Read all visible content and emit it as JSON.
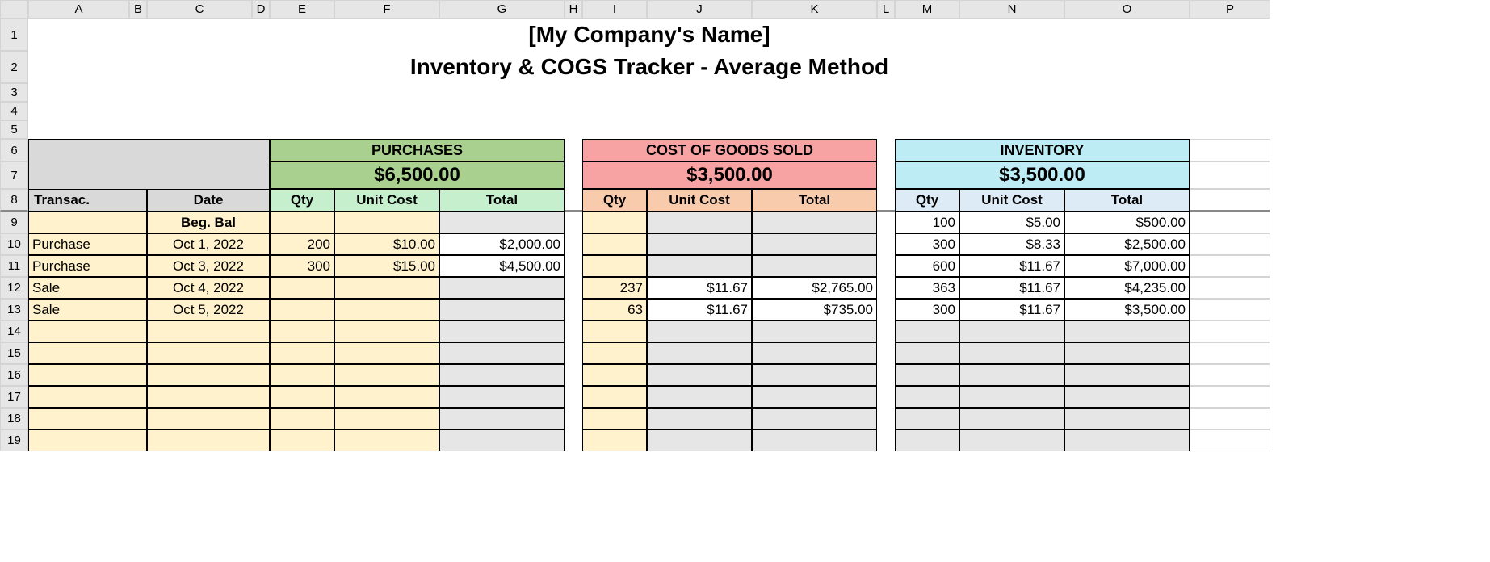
{
  "columns": [
    "",
    "A",
    "B",
    "C",
    "D",
    "E",
    "F",
    "G",
    "H",
    "I",
    "J",
    "K",
    "L",
    "M",
    "N",
    "O",
    "P"
  ],
  "title1": "[My Company's Name]",
  "title2": "Inventory & COGS Tracker - Average Method",
  "sections": {
    "purchases": {
      "label": "PURCHASES",
      "total": "$6,500.00"
    },
    "cogs": {
      "label": "COST OF GOODS SOLD",
      "total": "$3,500.00"
    },
    "inventory": {
      "label": "INVENTORY",
      "total": "$3,500.00"
    }
  },
  "headers": {
    "transac": "Transac.",
    "date": "Date",
    "qty": "Qty",
    "unitcost": "Unit Cost",
    "total": "Total"
  },
  "rows": [
    {
      "transac": "",
      "date": "Beg. Bal",
      "p_qty": "",
      "p_uc": "",
      "p_tot": "",
      "c_qty": "",
      "c_uc": "",
      "c_tot": "",
      "i_qty": "100",
      "i_uc": "$5.00",
      "i_tot": "$500.00"
    },
    {
      "transac": "Purchase",
      "date": "Oct 1, 2022",
      "p_qty": "200",
      "p_uc": "$10.00",
      "p_tot": "$2,000.00",
      "c_qty": "",
      "c_uc": "",
      "c_tot": "",
      "i_qty": "300",
      "i_uc": "$8.33",
      "i_tot": "$2,500.00"
    },
    {
      "transac": "Purchase",
      "date": "Oct 3, 2022",
      "p_qty": "300",
      "p_uc": "$15.00",
      "p_tot": "$4,500.00",
      "c_qty": "",
      "c_uc": "",
      "c_tot": "",
      "i_qty": "600",
      "i_uc": "$11.67",
      "i_tot": "$7,000.00"
    },
    {
      "transac": "Sale",
      "date": "Oct 4, 2022",
      "p_qty": "",
      "p_uc": "",
      "p_tot": "",
      "c_qty": "237",
      "c_uc": "$11.67",
      "c_tot": "$2,765.00",
      "i_qty": "363",
      "i_uc": "$11.67",
      "i_tot": "$4,235.00"
    },
    {
      "transac": "Sale",
      "date": "Oct 5, 2022",
      "p_qty": "",
      "p_uc": "",
      "p_tot": "",
      "c_qty": "63",
      "c_uc": "$11.67",
      "c_tot": "$735.00",
      "i_qty": "300",
      "i_uc": "$11.67",
      "i_tot": "$3,500.00"
    },
    {
      "transac": "",
      "date": "",
      "p_qty": "",
      "p_uc": "",
      "p_tot": "",
      "c_qty": "",
      "c_uc": "",
      "c_tot": "",
      "i_qty": "",
      "i_uc": "",
      "i_tot": ""
    },
    {
      "transac": "",
      "date": "",
      "p_qty": "",
      "p_uc": "",
      "p_tot": "",
      "c_qty": "",
      "c_uc": "",
      "c_tot": "",
      "i_qty": "",
      "i_uc": "",
      "i_tot": ""
    },
    {
      "transac": "",
      "date": "",
      "p_qty": "",
      "p_uc": "",
      "p_tot": "",
      "c_qty": "",
      "c_uc": "",
      "c_tot": "",
      "i_qty": "",
      "i_uc": "",
      "i_tot": ""
    },
    {
      "transac": "",
      "date": "",
      "p_qty": "",
      "p_uc": "",
      "p_tot": "",
      "c_qty": "",
      "c_uc": "",
      "c_tot": "",
      "i_qty": "",
      "i_uc": "",
      "i_tot": ""
    },
    {
      "transac": "",
      "date": "",
      "p_qty": "",
      "p_uc": "",
      "p_tot": "",
      "c_qty": "",
      "c_uc": "",
      "c_tot": "",
      "i_qty": "",
      "i_uc": "",
      "i_tot": ""
    },
    {
      "transac": "",
      "date": "",
      "p_qty": "",
      "p_uc": "",
      "p_tot": "",
      "c_qty": "",
      "c_uc": "",
      "c_tot": "",
      "i_qty": "",
      "i_uc": "",
      "i_tot": ""
    }
  ],
  "chart_data": {
    "type": "table",
    "title": "Inventory & COGS Tracker - Average Method",
    "summary": {
      "purchases_total": 6500.0,
      "cogs_total": 3500.0,
      "inventory_total": 3500.0
    },
    "columns": [
      "Transac.",
      "Date",
      "Purchase Qty",
      "Purchase Unit Cost",
      "Purchase Total",
      "COGS Qty",
      "COGS Unit Cost",
      "COGS Total",
      "Inventory Qty",
      "Inventory Unit Cost",
      "Inventory Total"
    ],
    "records": [
      {
        "transac": "",
        "date": "Beg. Bal",
        "purchase_qty": null,
        "purchase_unit_cost": null,
        "purchase_total": null,
        "cogs_qty": null,
        "cogs_unit_cost": null,
        "cogs_total": null,
        "inv_qty": 100,
        "inv_unit_cost": 5.0,
        "inv_total": 500.0
      },
      {
        "transac": "Purchase",
        "date": "Oct 1, 2022",
        "purchase_qty": 200,
        "purchase_unit_cost": 10.0,
        "purchase_total": 2000.0,
        "cogs_qty": null,
        "cogs_unit_cost": null,
        "cogs_total": null,
        "inv_qty": 300,
        "inv_unit_cost": 8.33,
        "inv_total": 2500.0
      },
      {
        "transac": "Purchase",
        "date": "Oct 3, 2022",
        "purchase_qty": 300,
        "purchase_unit_cost": 15.0,
        "purchase_total": 4500.0,
        "cogs_qty": null,
        "cogs_unit_cost": null,
        "cogs_total": null,
        "inv_qty": 600,
        "inv_unit_cost": 11.67,
        "inv_total": 7000.0
      },
      {
        "transac": "Sale",
        "date": "Oct 4, 2022",
        "purchase_qty": null,
        "purchase_unit_cost": null,
        "purchase_total": null,
        "cogs_qty": 237,
        "cogs_unit_cost": 11.67,
        "cogs_total": 2765.0,
        "inv_qty": 363,
        "inv_unit_cost": 11.67,
        "inv_total": 4235.0
      },
      {
        "transac": "Sale",
        "date": "Oct 5, 2022",
        "purchase_qty": null,
        "purchase_unit_cost": null,
        "purchase_total": null,
        "cogs_qty": 63,
        "cogs_unit_cost": 11.67,
        "cogs_total": 735.0,
        "inv_qty": 300,
        "inv_unit_cost": 11.67,
        "inv_total": 3500.0
      }
    ]
  }
}
